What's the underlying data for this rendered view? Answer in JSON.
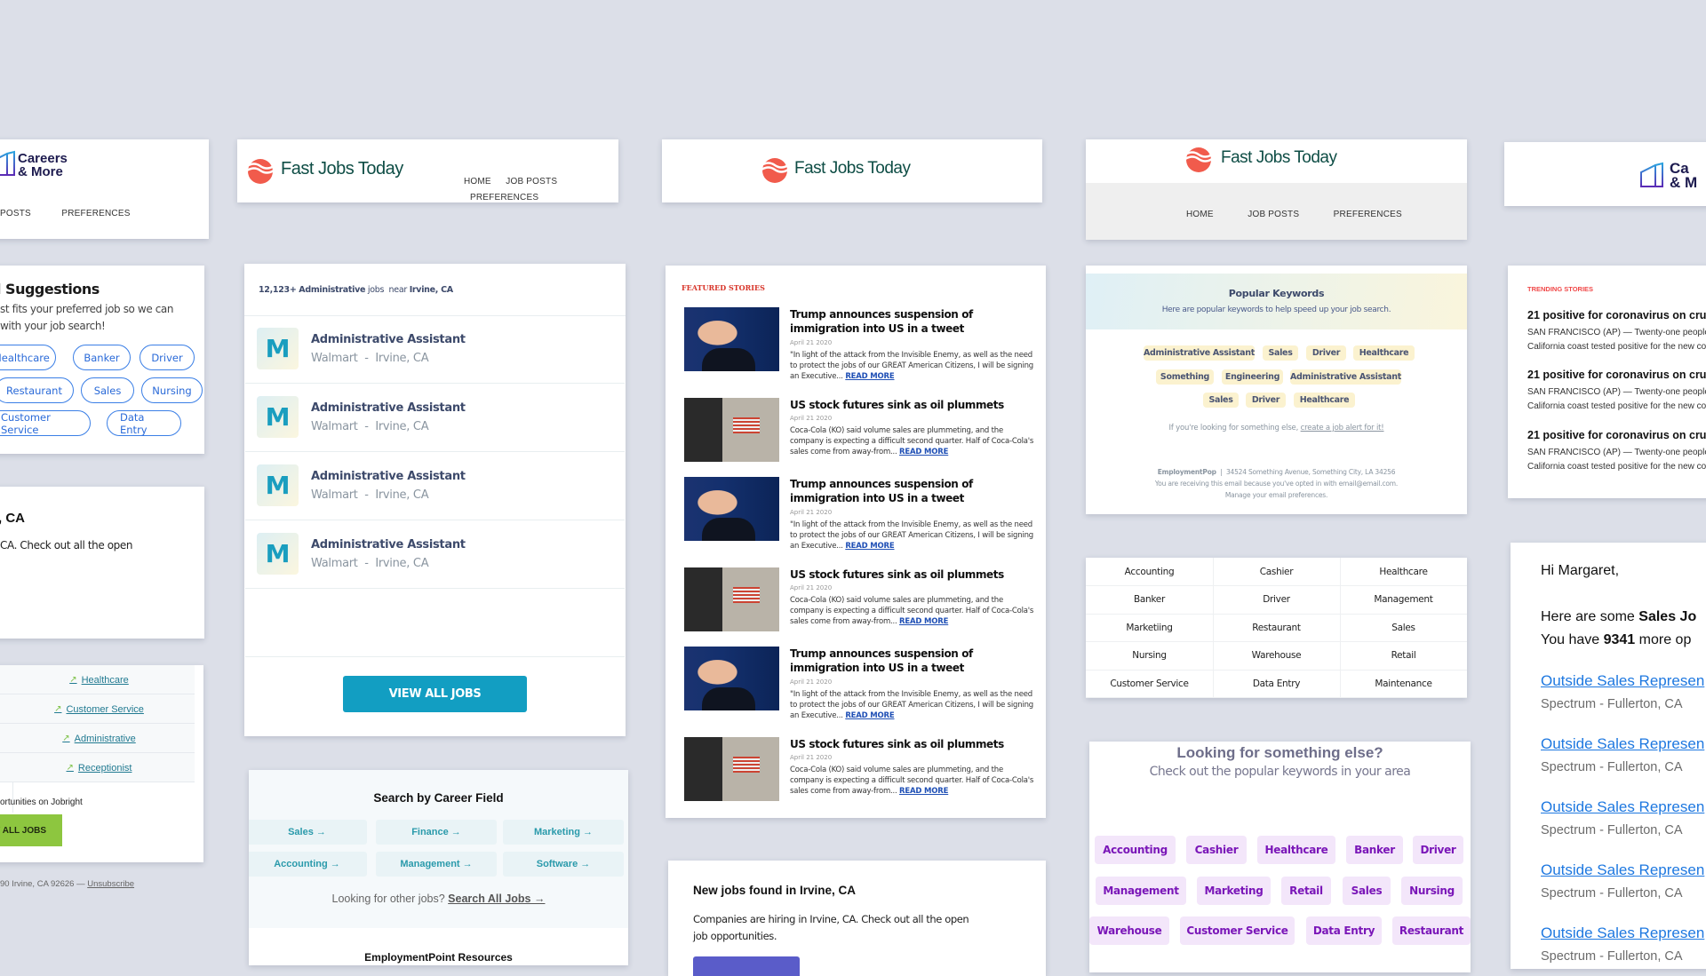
{
  "colors": {
    "background": "#dcdfe8",
    "fast_jobs_red": "#f15b4c",
    "fast_jobs_green": "#0e4d45",
    "careers_navy": "#1d1b4f",
    "outline_blue": "#3b7fe6",
    "teal_button": "#129ec2",
    "green_button": "#8dc63f",
    "purple_chip_text": "#7a16b8",
    "purple_chip_bg": "#f3e6fa",
    "yellow_chip_bg": "#fbf2cf",
    "link_blue": "#1e78e0",
    "featured_red": "#d8352a"
  },
  "col1": {
    "header": {
      "logo_line1": "Careers",
      "logo_line2": "& More",
      "nav": [
        "POSTS",
        "PREFERENCES"
      ]
    },
    "suggestions": {
      "title": "l Suggestions",
      "text_line1": "st fits your preferred job so we can",
      "text_line2": " with your job search!",
      "pills": [
        "Healthcare",
        "Banker",
        "Driver",
        "Restaurant",
        "Sales",
        "Nursing",
        "Customer Service",
        "Data Entry"
      ]
    },
    "new_jobs": {
      "title": ", CA",
      "text": "CA. Check out all the open"
    },
    "trending_table": {
      "rows": [
        "Healthcare",
        "Customer Service",
        "Administrative",
        "Receptionist"
      ],
      "trend_icon": "trending-up-icon"
    },
    "footer_text": "ortunities on Jobright",
    "button_label": "V ALL JOBS",
    "address": "90 Irvine, CA 92626 —",
    "unsubscribe": "Unsubscribe"
  },
  "col2": {
    "header": {
      "brand": "Fast Jobs Today",
      "nav": [
        "HOME",
        "JOB POSTS",
        "PREFERENCES"
      ]
    },
    "jobs_card": {
      "count": "12,123+",
      "keyword": "Administrative",
      "jobs_word": "jobs",
      "near_word": "near",
      "location": "Irvine, CA",
      "jobs": [
        {
          "logo": "M",
          "title": "Administrative Assistant",
          "company": "Walmart",
          "location": "Irvine, CA"
        },
        {
          "logo": "M",
          "title": "Administrative Assistant",
          "company": "Walmart",
          "location": "Irvine, CA"
        },
        {
          "logo": "M",
          "title": "Administrative Assistant",
          "company": "Walmart",
          "location": "Irvine, CA"
        },
        {
          "logo": "M",
          "title": "Administrative Assistant",
          "company": "Walmart",
          "location": "Irvine, CA"
        }
      ],
      "separator": "-",
      "button_label": "VIEW ALL JOBS"
    },
    "career_field": {
      "title": "Search by Career Field",
      "fields": [
        "Sales →",
        "Finance →",
        "Marketing →",
        "Accounting →",
        "Management →",
        "Software →"
      ],
      "other_text": "Looking for other jobs?",
      "search_all": "Search All Jobs →",
      "resources_title": "EmploymentPoint Resources"
    }
  },
  "col3": {
    "header": {
      "brand": "Fast Jobs Today"
    },
    "featured": {
      "label": "FEATURED STORIES",
      "read_more": "READ MORE",
      "stories": [
        {
          "image": "trump-photo",
          "title": "Trump announces suspension of immigration into US in a tweet",
          "date": "April 21 2020",
          "body": "\"In light of the attack from the Invisible Enemy, as well as the need to protect the jobs of our GREAT American Citizens, I will be signing an Executive..."
        },
        {
          "image": "nyse-photo",
          "title": "US stock futures sink as oil plummets",
          "date": "April 21 2020",
          "body": "Coca-Cola (KO) said volume sales are plummeting, and the company is expecting a difficult second quarter. Half of Coca-Cola's sales come from away-from..."
        },
        {
          "image": "trump-photo",
          "title": "Trump announces suspension of immigration into US in a tweet",
          "date": "April 21 2020",
          "body": "\"In light of the attack from the Invisible Enemy, as well as the need to protect the jobs of our GREAT American Citizens, I will be signing an Executive..."
        },
        {
          "image": "nyse-photo",
          "title": "US stock futures sink as oil plummets",
          "date": "April 21 2020",
          "body": "Coca-Cola (KO) said volume sales are plummeting, and the company is expecting a difficult second quarter. Half of Coca-Cola's sales come from away-from..."
        },
        {
          "image": "trump-photo",
          "title": "Trump announces suspension of immigration into US in a tweet",
          "date": "April 21 2020",
          "body": "\"In light of the attack from the Invisible Enemy, as well as the need to protect the jobs of our GREAT American Citizens, I will be signing an Executive..."
        },
        {
          "image": "nyse-photo",
          "title": "US stock futures sink as oil plummets",
          "date": "April 21 2020",
          "body": "Coca-Cola (KO) said volume sales are plummeting, and the company is expecting a difficult second quarter. Half of Coca-Cola's sales come from away-from..."
        }
      ]
    },
    "new_jobs": {
      "title": "New jobs found in Irvine, CA",
      "text_line1": "Companies are hiring in Irvine, CA. Check out all the open",
      "text_line2": "job opportunities."
    }
  },
  "col4": {
    "header": {
      "brand": "Fast Jobs Today",
      "nav": [
        "HOME",
        "JOB POSTS",
        "PREFERENCES"
      ]
    },
    "popular": {
      "title": "Popular Keywords",
      "subtitle": "Here are popular keywords to help speed up your job search.",
      "chips": [
        "Administrative Assistant",
        "Sales",
        "Driver",
        "Healthcare",
        "Something",
        "Engineering",
        "Administrative Assistant",
        "Sales",
        "Driver",
        "Healthcare"
      ],
      "else_text": "If you're looking for something else,",
      "else_link": "create a job alert for it!",
      "company": "EmploymentPop",
      "divider": "|",
      "address": "34524 Something Avenue, Something City, LA 34256",
      "opted_in": "You are receiving this email because you've opted in with email@email.com.",
      "manage": "Manage your email preferences."
    },
    "keyword_grid": [
      "Accounting",
      "Cashier",
      "Healthcare",
      "Banker",
      "Driver",
      "Management",
      "Marketiing",
      "Restaurant",
      "Sales",
      "Nursing",
      "Warehouse",
      "Retail",
      "Customer Service",
      "Data Entry",
      "Maintenance"
    ],
    "looking_else": {
      "title": "Looking for something else?",
      "subtitle": "Check out the popular keywords in your area",
      "chips": [
        "Accounting",
        "Cashier",
        "Healthcare",
        "Banker",
        "Driver",
        "Management",
        "Marketing",
        "Retail",
        "Sales",
        "Nursing",
        "Warehouse",
        "Customer Service",
        "Data Entry",
        "Restaurant"
      ]
    }
  },
  "col5": {
    "header": {
      "logo_line1": "Ca",
      "logo_line2": "& M"
    },
    "trending": {
      "label": "TRENDING STORIES",
      "stories": [
        {
          "title": "21 positive for coronavirus on cruis",
          "line1": "SAN FRANCISCO (AP) — Twenty-one people a",
          "line2": "California coast tested positive for the new co"
        },
        {
          "title": "21 positive for coronavirus on cruis",
          "line1": "SAN FRANCISCO (AP) — Twenty-one people a",
          "line2": "California coast tested positive for the new co"
        },
        {
          "title": "21 positive for coronavirus on cruis",
          "line1": "SAN FRANCISCO (AP) — Twenty-one people a",
          "line2": "California coast tested positive for the new co"
        }
      ]
    },
    "sales_email": {
      "greeting": "Hi Margaret,",
      "line1_pre": "Here are some",
      "line1_bold": "Sales Jo",
      "line2_pre": "You have",
      "line2_bold": "9341",
      "line2_post": "more op",
      "jobs": [
        {
          "title": "Outside Sales Represen",
          "sub": "Spectrum - Fullerton, CA"
        },
        {
          "title": "Outside Sales Represen",
          "sub": "Spectrum - Fullerton, CA"
        },
        {
          "title": "Outside Sales Represen",
          "sub": "Spectrum - Fullerton, CA"
        },
        {
          "title": "Outside Sales Represen",
          "sub": "Spectrum - Fullerton, CA"
        },
        {
          "title": "Outside Sales Represen",
          "sub": "Spectrum - Fullerton, CA"
        }
      ]
    }
  }
}
